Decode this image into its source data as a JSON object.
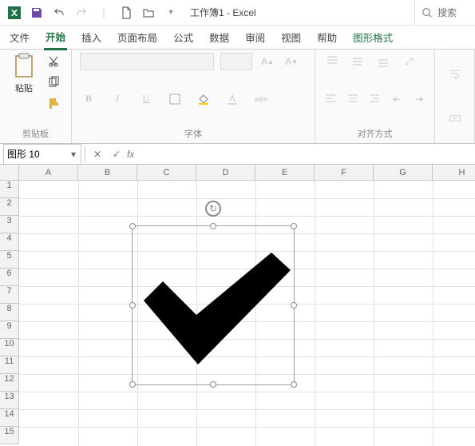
{
  "app": {
    "title": "工作簿1 - Excel"
  },
  "search": {
    "placeholder": "搜索"
  },
  "tabs": {
    "file": "文件",
    "home": "开始",
    "insert": "插入",
    "layout": "页面布局",
    "formula": "公式",
    "data": "数据",
    "review": "审阅",
    "view": "视图",
    "help": "帮助",
    "shapeformat": "图形格式"
  },
  "ribbon": {
    "clipboard": {
      "paste": "粘贴",
      "group": "剪贴板"
    },
    "font": {
      "bold": "B",
      "italic": "I",
      "underline": "U",
      "wen": "wen",
      "group": "字体"
    },
    "align": {
      "group": "对齐方式"
    }
  },
  "namebox": {
    "value": "图形 10"
  },
  "formulabar": {
    "fx": "fx",
    "value": ""
  },
  "columns": [
    "A",
    "B",
    "C",
    "D",
    "E",
    "F",
    "G",
    "H"
  ],
  "rows": [
    "1",
    "2",
    "3",
    "4",
    "5",
    "6",
    "7",
    "8",
    "9",
    "10",
    "11",
    "12",
    "13",
    "14",
    "15"
  ],
  "shape": {
    "name": "checkmark"
  }
}
